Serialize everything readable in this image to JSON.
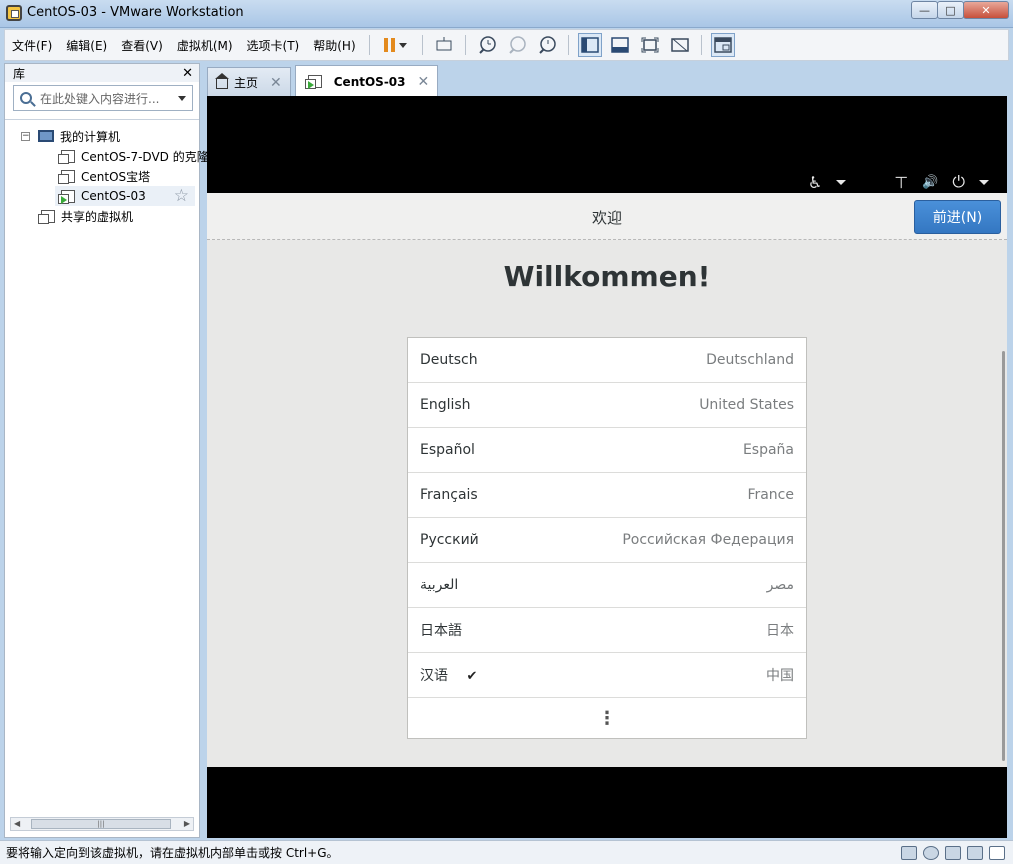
{
  "window": {
    "title": "CentOS-03 - VMware Workstation",
    "minimize": "—",
    "maximize": "□",
    "close": "✕"
  },
  "menu": [
    "文件(F)",
    "编辑(E)",
    "查看(V)",
    "虚拟机(M)",
    "选项卡(T)",
    "帮助(H)"
  ],
  "library": {
    "title": "库",
    "close": "✕",
    "search_placeholder": "在此处键入内容进行...",
    "tree": {
      "root": "我的计算机",
      "items": [
        "CentOS-7-DVD 的克隆",
        "CentOS宝塔",
        "CentOS-03"
      ],
      "shared": "共享的虚拟机"
    },
    "scroll_thumb": "|||"
  },
  "tabs": [
    {
      "label": "主页",
      "close": "✕"
    },
    {
      "label": "CentOS-03",
      "close": "✕"
    }
  ],
  "installer": {
    "header_title": "欢迎",
    "next_button": "前进(N)",
    "welcome": "Willkommen!",
    "languages": [
      {
        "native": "Deutsch",
        "region": "Deutschland"
      },
      {
        "native": "English",
        "region": "United States"
      },
      {
        "native": "Español",
        "region": "España"
      },
      {
        "native": "Français",
        "region": "France"
      },
      {
        "native": "Русский",
        "region": "Российская Федерация"
      },
      {
        "native": "العربية",
        "region": "مصر"
      },
      {
        "native": "日本語",
        "region": "日本"
      },
      {
        "native": "汉语",
        "region": "中国",
        "checked": "✔"
      }
    ],
    "more": "⋮"
  },
  "gnome_topbar": {
    "accessibility": "♿",
    "network": "⊤",
    "volume": "🔊",
    "power": "⏻"
  },
  "status": {
    "text": "要将输入定向到该虚拟机，请在虚拟机内部单击或按 Ctrl+G。"
  }
}
